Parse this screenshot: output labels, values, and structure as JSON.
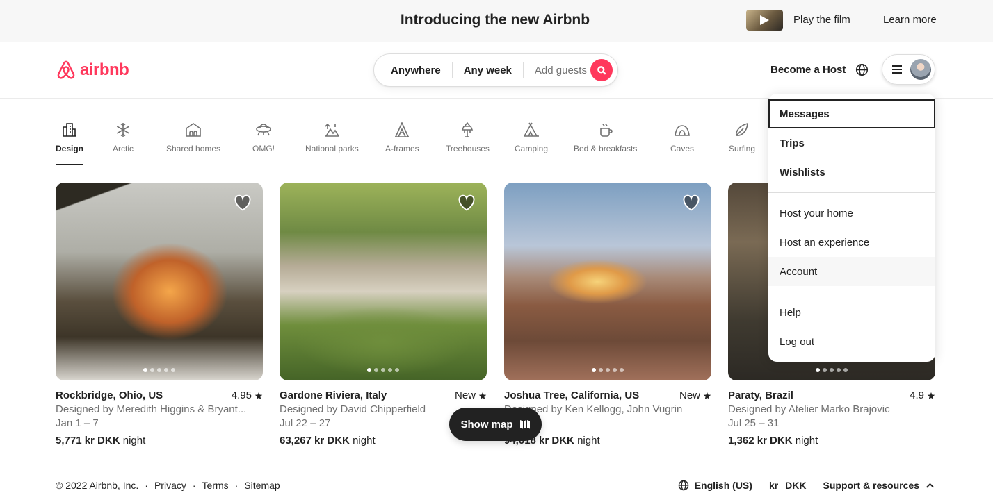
{
  "promo": {
    "title": "Introducing the new Airbnb",
    "play_label": "Play the film",
    "learn_label": "Learn more"
  },
  "header": {
    "logo_text": "airbnb",
    "search": {
      "where": "Anywhere",
      "when": "Any week",
      "guests_placeholder": "Add guests"
    },
    "host_label": "Become a Host",
    "icons": [
      "airbnb-logo-icon",
      "search-icon",
      "globe-icon",
      "hamburger-menu-icon",
      "avatar"
    ]
  },
  "categories": [
    {
      "label": "Design",
      "icon": "design-icon",
      "active": true
    },
    {
      "label": "Arctic",
      "icon": "snowflake-icon"
    },
    {
      "label": "Shared homes",
      "icon": "shared-home-icon"
    },
    {
      "label": "OMG!",
      "icon": "ufo-icon"
    },
    {
      "label": "National parks",
      "icon": "national-park-icon"
    },
    {
      "label": "A-frames",
      "icon": "a-frame-icon"
    },
    {
      "label": "Treehouses",
      "icon": "treehouse-icon"
    },
    {
      "label": "Camping",
      "icon": "camping-icon"
    },
    {
      "label": "Bed & breakfasts",
      "icon": "bed-breakfast-icon"
    },
    {
      "label": "Caves",
      "icon": "cave-icon"
    },
    {
      "label": "Surfing",
      "icon": "surfboard-icon"
    }
  ],
  "listings": [
    {
      "location": "Rockbridge, Ohio, US",
      "rating": "4.95",
      "designer": "Designed by Meredith Higgins & Bryant...",
      "dates": "Jan 1 – 7",
      "price": "5,771 kr DKK",
      "unit": "night"
    },
    {
      "location": "Gardone Riviera, Italy",
      "rating": "New",
      "designer": "Designed by David Chipperfield",
      "dates": "Jul 22 – 27",
      "price": "63,267 kr DKK",
      "unit": "night"
    },
    {
      "location": "Joshua Tree, California, US",
      "rating": "New",
      "designer": "Designed by Ken Kellogg, John Vugrin",
      "dates": "Jun 4",
      "price": "94,018 kr DKK",
      "unit": "night"
    },
    {
      "location": "Paraty, Brazil",
      "rating": "4.9",
      "designer": "Designed by Atelier Marko Brajovic",
      "dates": "Jul 25 – 31",
      "price": "1,362 kr DKK",
      "unit": "night"
    }
  ],
  "show_map_label": "Show map",
  "menu": {
    "items": [
      "Messages",
      "Trips",
      "Wishlists",
      "Host your home",
      "Host an experience",
      "Account",
      "Help",
      "Log out"
    ]
  },
  "footer": {
    "copyright": "© 2022 Airbnb, Inc.",
    "links": [
      "Privacy",
      "Terms",
      "Sitemap"
    ],
    "separator": "·",
    "language": "English (US)",
    "currency_symbol": "kr",
    "currency_code": "DKK",
    "support": "Support & resources"
  },
  "colors": {
    "brand": "#ff385c",
    "text": "#222222",
    "muted": "#717171"
  }
}
